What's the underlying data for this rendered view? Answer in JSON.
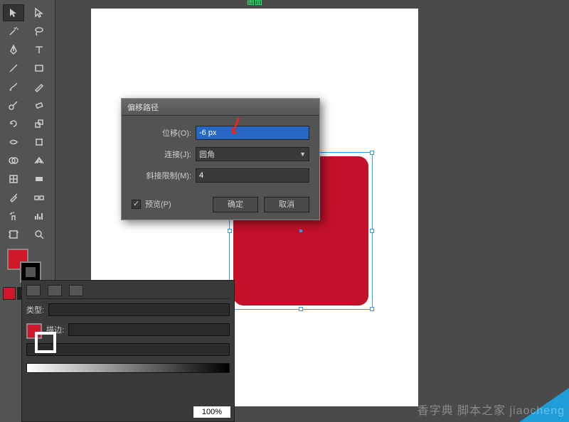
{
  "artboard": {
    "label": "画面"
  },
  "dialog": {
    "title": "偏移路径",
    "offset_label": "位移(O):",
    "offset_value": "-6 px",
    "join_label": "连接(J):",
    "join_value": "圆角",
    "miter_label": "斜接限制(M):",
    "miter_value": "4",
    "preview_label": "预览(P)",
    "preview_checked": true,
    "ok": "确定",
    "cancel": "取消"
  },
  "colors": {
    "fill": "#d01629",
    "stroke": "#000000",
    "object": "#c21129",
    "selection": "#2a9df4"
  },
  "panels": {
    "type_label": "类型:",
    "stroke_label": "描边:",
    "zoom": "100%"
  },
  "tools": [
    "selection",
    "direct-selection",
    "magic-wand",
    "lasso",
    "pen",
    "type",
    "line-segment",
    "rectangle",
    "paintbrush",
    "pencil",
    "blob-brush",
    "eraser",
    "rotate",
    "scale",
    "width",
    "free-transform",
    "shape-builder",
    "perspective-grid",
    "mesh",
    "gradient",
    "eyedropper",
    "blend",
    "symbol-sprayer",
    "column-graph",
    "artboard",
    "zoom"
  ],
  "watermark": "香字典 脚本之家 jiaocheng"
}
